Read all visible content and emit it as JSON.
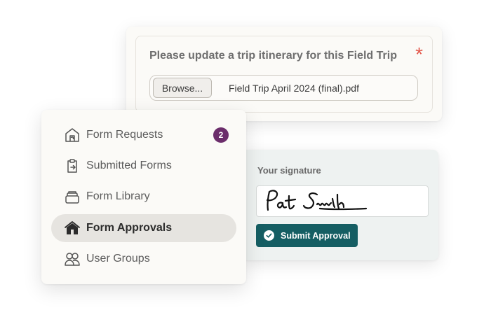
{
  "upload": {
    "title": "Please update a trip itinerary for this Field Trip",
    "required_marker": "*",
    "browse_label": "Browse...",
    "file_name": "Field Trip April 2024 (final).pdf"
  },
  "menu": {
    "items": [
      {
        "label": "Form Requests",
        "icon": "inbox-home-icon",
        "badge": "2",
        "active": false
      },
      {
        "label": "Submitted Forms",
        "icon": "clipboard-export-icon",
        "active": false
      },
      {
        "label": "Form Library",
        "icon": "stack-icon",
        "active": false
      },
      {
        "label": "Form Approvals",
        "icon": "home-icon",
        "active": true
      },
      {
        "label": "User Groups",
        "icon": "users-icon",
        "active": false
      }
    ]
  },
  "signature": {
    "label": "Your signature",
    "signed_name": "Pat Smith",
    "submit_label": "Submit Approval"
  },
  "colors": {
    "accent_teal": "#155e63",
    "badge_purple": "#6b2d6b",
    "required_red": "#e3584c"
  }
}
